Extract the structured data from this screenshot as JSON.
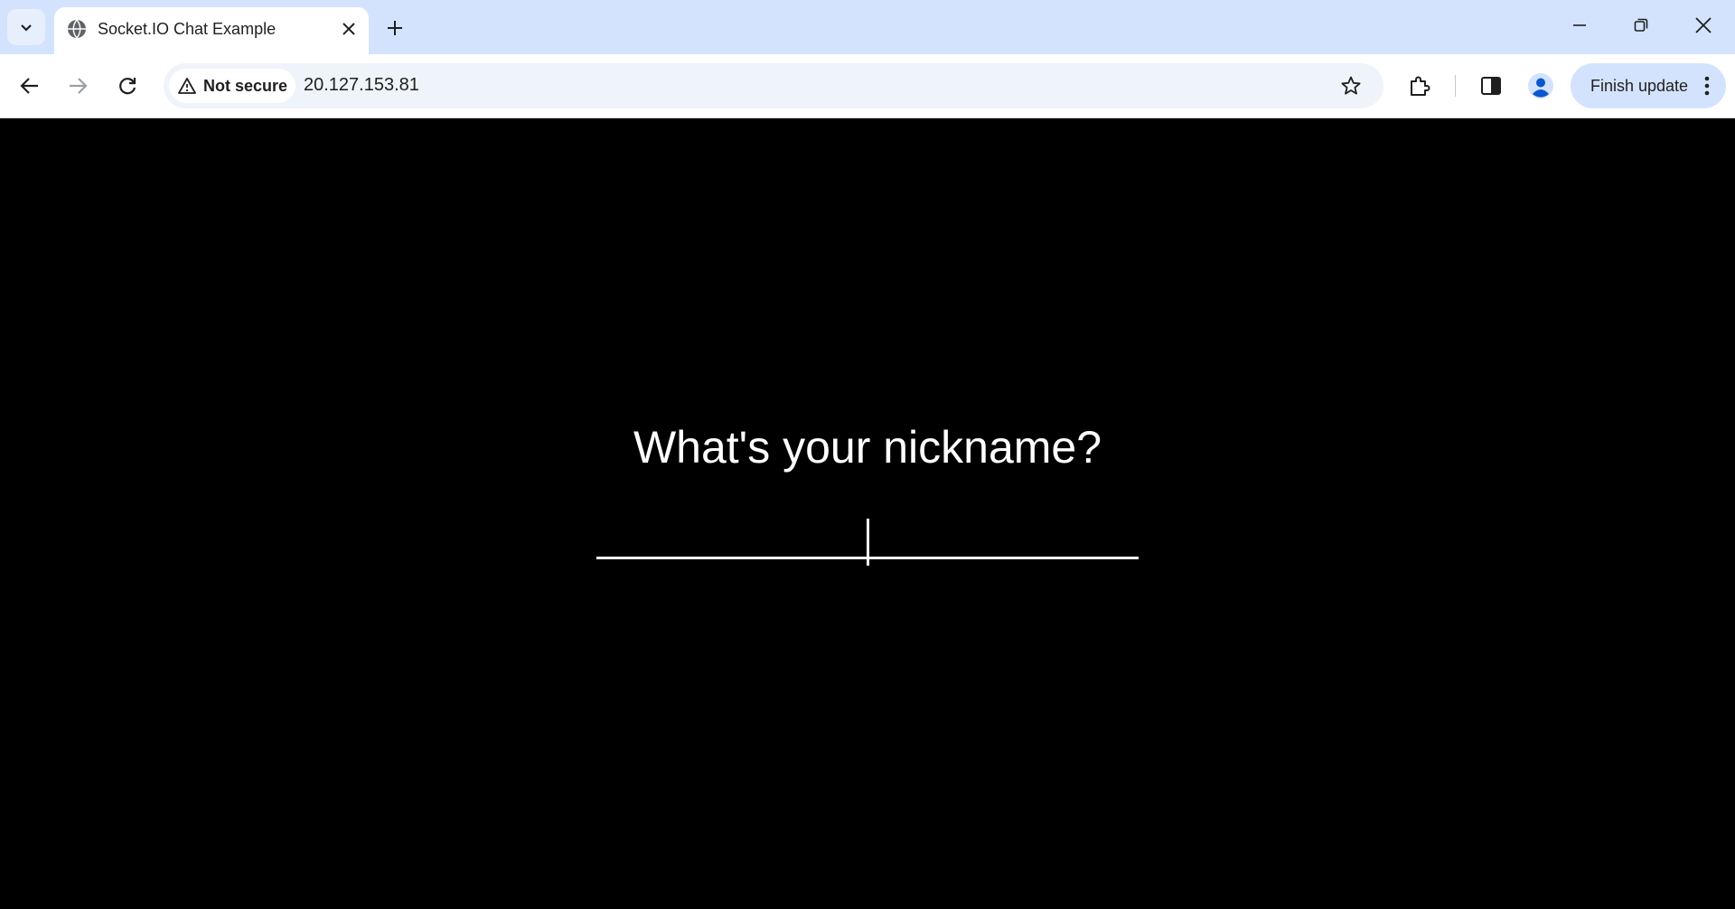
{
  "browser": {
    "tab": {
      "title": "Socket.IO Chat Example",
      "favicon": "globe-icon"
    },
    "address_bar": {
      "security_label": "Not secure",
      "url": "20.127.153.81"
    },
    "finish_update_label": "Finish update",
    "colors": {
      "tabstrip": "#d3e3fd",
      "omnibox": "#eff3fa",
      "profile": "#0b57d0"
    }
  },
  "page": {
    "title": "What's your nickname?",
    "nickname_input": {
      "value": "",
      "placeholder": ""
    },
    "colors": {
      "background": "#000000",
      "text": "#ffffff"
    }
  }
}
